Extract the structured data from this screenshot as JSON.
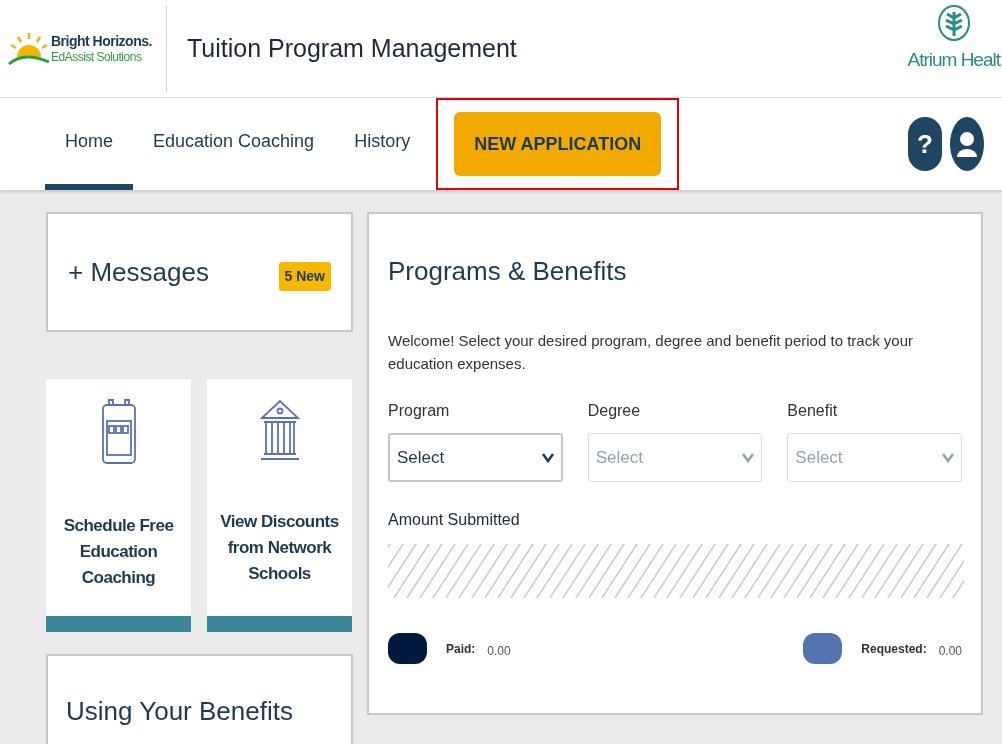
{
  "header": {
    "brand": {
      "name": "Bright Horizons.",
      "subtitle": "EdAssist Solutions"
    },
    "title": "Tuition Program Management",
    "partner_logo": "Atrium Healt"
  },
  "nav": {
    "tabs": [
      {
        "label": "Home",
        "selected": true
      },
      {
        "label": "Education Coaching",
        "selected": false
      },
      {
        "label": "History",
        "selected": false
      }
    ],
    "primary_button": {
      "label": "NEW APPLICATION",
      "highlighted": true
    },
    "help_icon": "?"
  },
  "messages": {
    "title": "+ Messages",
    "badge": "5 New"
  },
  "tiles": [
    {
      "kind": "calendar",
      "label": "Schedule Free Education Coaching"
    },
    {
      "kind": "bank",
      "label": "View Discounts from Network Schools"
    }
  ],
  "benefits_card": {
    "title": "Using Your Benefits"
  },
  "programs": {
    "title": "Programs & Benefits",
    "intro": "Welcome! Select your desired program, degree and benefit period to track your education expenses.",
    "selects": [
      {
        "label": "Program",
        "placeholder": "Select",
        "disabled": false
      },
      {
        "label": "Degree",
        "placeholder": "Select",
        "disabled": true
      },
      {
        "label": "Benefit",
        "placeholder": "Select",
        "disabled": true
      }
    ],
    "amount_label": "Amount Submitted",
    "legend": [
      {
        "label": "Paid:",
        "value": "0.00",
        "color": "#001a3d"
      },
      {
        "label": "Requested:",
        "value": "0.00",
        "color": "#5473b0"
      }
    ]
  }
}
